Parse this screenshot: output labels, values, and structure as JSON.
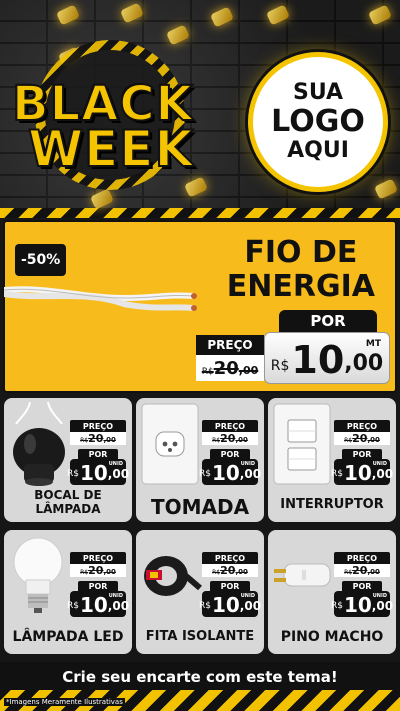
{
  "header": {
    "brand_line1": "BLACK",
    "brand_line2": "WEEK",
    "logo_line1": "SUA",
    "logo_line2": "LOGO",
    "logo_line3": "AQUI"
  },
  "hero": {
    "discount_badge": "-50%",
    "title_line1": "FIO DE",
    "title_line2": "ENERGIA",
    "por_label": "POR",
    "preco_label": "PREÇO",
    "old_price": {
      "currency": "R$",
      "int": "20",
      "dec": ",00"
    },
    "new_price": {
      "currency": "R$",
      "int": "10",
      "dec": ",00",
      "unit": "MT"
    }
  },
  "products": [
    {
      "name_line1": "BOCAL DE",
      "name_line2": "LÂMPADA",
      "preco_label": "PREÇO",
      "por_label": "POR",
      "old": {
        "currency": "R$",
        "int": "20",
        "dec": ",00"
      },
      "new": {
        "currency": "R$",
        "int": "10",
        "dec": ",00",
        "unit": "UNID"
      }
    },
    {
      "name": "TOMADA",
      "preco_label": "PREÇO",
      "por_label": "POR",
      "old": {
        "currency": "R$",
        "int": "20",
        "dec": ",00"
      },
      "new": {
        "currency": "R$",
        "int": "10",
        "dec": ",00",
        "unit": "UNID"
      }
    },
    {
      "name": "INTERRUPTOR",
      "preco_label": "PREÇO",
      "por_label": "POR",
      "old": {
        "currency": "R$",
        "int": "20",
        "dec": ",00"
      },
      "new": {
        "currency": "R$",
        "int": "10",
        "dec": ",00",
        "unit": "UNID"
      }
    },
    {
      "name": "LÂMPADA LED",
      "preco_label": "PREÇO",
      "por_label": "POR",
      "old": {
        "currency": "R$",
        "int": "20",
        "dec": ",00"
      },
      "new": {
        "currency": "R$",
        "int": "10",
        "dec": ",00",
        "unit": "UNID"
      }
    },
    {
      "name": "FITA ISOLANTE",
      "preco_label": "PREÇO",
      "por_label": "POR",
      "old": {
        "currency": "R$",
        "int": "20",
        "dec": ",00"
      },
      "new": {
        "currency": "R$",
        "int": "10",
        "dec": ",00",
        "unit": "UNID"
      }
    },
    {
      "name": "PINO MACHO",
      "preco_label": "PREÇO",
      "por_label": "POR",
      "old": {
        "currency": "R$",
        "int": "20",
        "dec": ",00"
      },
      "new": {
        "currency": "R$",
        "int": "10",
        "dec": ",00",
        "unit": "UNID"
      }
    }
  ],
  "footer": {
    "cta": "Crie seu encarte com este tema!",
    "footnote": "*Imagens Meramente Ilustrativas"
  },
  "colors": {
    "accent_yellow": "#f7bb1c",
    "dark": "#111111",
    "card_gray": "#d8d8d8"
  },
  "icons": [
    "wire-cable-icon",
    "lamp-socket-icon",
    "power-outlet-icon",
    "light-switch-icon",
    "led-bulb-icon",
    "insulating-tape-icon",
    "male-plug-icon"
  ]
}
